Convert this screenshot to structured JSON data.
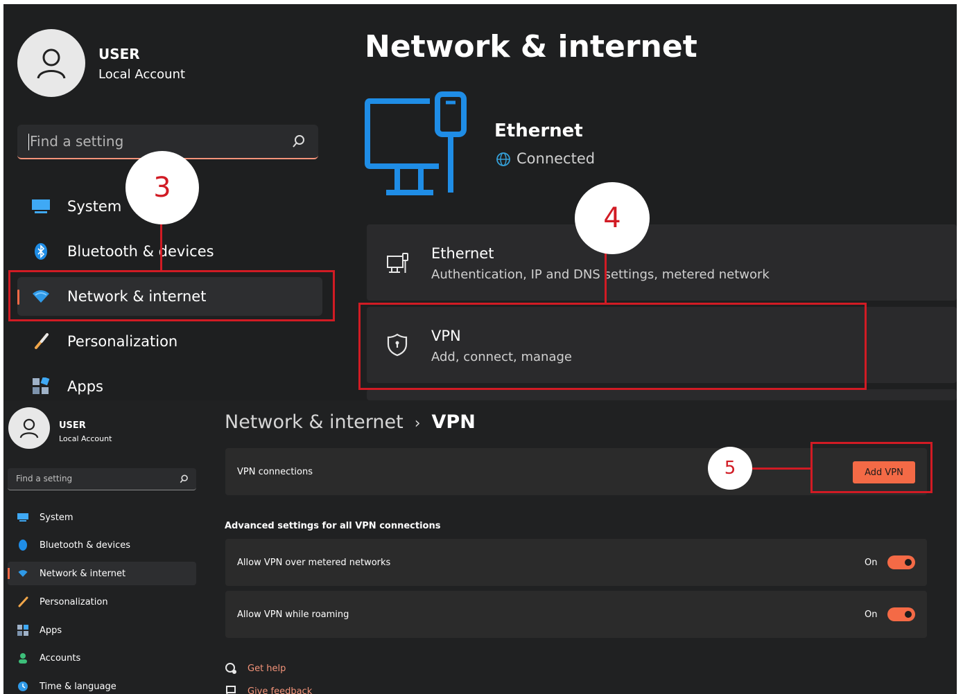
{
  "top": {
    "user": {
      "name": "USER",
      "account": "Local Account"
    },
    "search": {
      "placeholder": "Find a setting"
    },
    "nav": [
      {
        "label": "System"
      },
      {
        "label": "Bluetooth & devices"
      },
      {
        "label": "Network & internet"
      },
      {
        "label": "Personalization"
      },
      {
        "label": "Apps"
      }
    ],
    "page_title": "Network & internet",
    "status": {
      "name": "Ethernet",
      "state": "Connected"
    },
    "cards": [
      {
        "title": "Ethernet",
        "subtitle": "Authentication, IP and DNS settings, metered network"
      },
      {
        "title": "VPN",
        "subtitle": "Add, connect, manage"
      }
    ]
  },
  "bottom": {
    "user": {
      "name": "USER",
      "account": "Local Account"
    },
    "search": {
      "placeholder": "Find a setting"
    },
    "nav": [
      {
        "label": "System"
      },
      {
        "label": "Bluetooth & devices"
      },
      {
        "label": "Network & internet"
      },
      {
        "label": "Personalization"
      },
      {
        "label": "Apps"
      },
      {
        "label": "Accounts"
      },
      {
        "label": "Time & language"
      }
    ],
    "breadcrumb": {
      "parent": "Network & internet",
      "separator": "›",
      "current": "VPN"
    },
    "vpn_connections": {
      "label": "VPN connections",
      "button": "Add VPN"
    },
    "advanced_heading": "Advanced settings for all VPN connections",
    "settings": [
      {
        "label": "Allow VPN over metered networks",
        "state": "On"
      },
      {
        "label": "Allow VPN while roaming",
        "state": "On"
      }
    ],
    "links": [
      {
        "label": "Get help"
      },
      {
        "label": "Give feedback"
      }
    ]
  },
  "annotations": {
    "step3": "3",
    "step4": "4",
    "step5": "5"
  },
  "colors": {
    "accent": "#f46a46",
    "annotation_red": "#d11b24",
    "background": "#1e1f20",
    "card": "#2b2b2b",
    "icon_blue": "#1f8de6"
  }
}
